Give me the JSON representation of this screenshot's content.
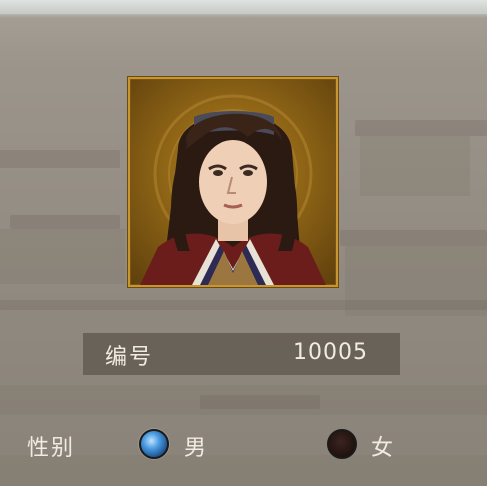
{
  "profile": {
    "id_label": "编号",
    "id_value": "10005"
  },
  "gender": {
    "label": "性别",
    "options": [
      {
        "label": "男",
        "selected": true
      },
      {
        "label": "女",
        "selected": false
      }
    ]
  },
  "colors": {
    "frame_gold": "#c9962e",
    "text": "#f1ece2",
    "radio_selected": "#4b9be0",
    "radio_unselected": "#23130f"
  },
  "icons": {
    "portrait": "character-portrait-icon",
    "male_radio": "radio-selected-icon",
    "female_radio": "radio-unselected-icon"
  }
}
